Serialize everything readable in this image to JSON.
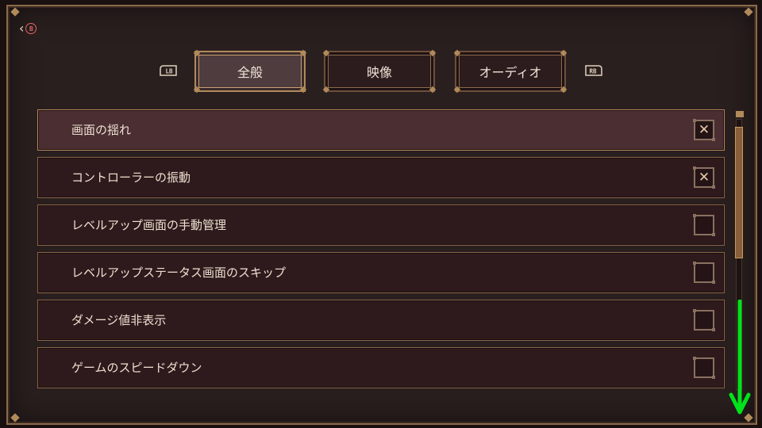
{
  "nav": {
    "back_button_glyph": "B",
    "lb_label": "LB",
    "rb_label": "RB"
  },
  "tabs": [
    {
      "label": "全般",
      "active": true
    },
    {
      "label": "映像",
      "active": false
    },
    {
      "label": "オーディオ",
      "active": false
    }
  ],
  "settings": [
    {
      "label": "画面の揺れ",
      "checked": true,
      "mark": "✕"
    },
    {
      "label": "コントローラーの振動",
      "checked": true,
      "mark": "✕"
    },
    {
      "label": "レベルアップ画面の手動管理",
      "checked": false,
      "mark": ""
    },
    {
      "label": "レベルアップステータス画面のスキップ",
      "checked": false,
      "mark": ""
    },
    {
      "label": "ダメージ値非表示",
      "checked": false,
      "mark": ""
    },
    {
      "label": "ゲームのスピードダウン",
      "checked": false,
      "mark": ""
    }
  ],
  "colors": {
    "frame_border": "#8a6a4a",
    "selected_row": "#4a2e32",
    "overlay_arrow": "#00e21a"
  }
}
